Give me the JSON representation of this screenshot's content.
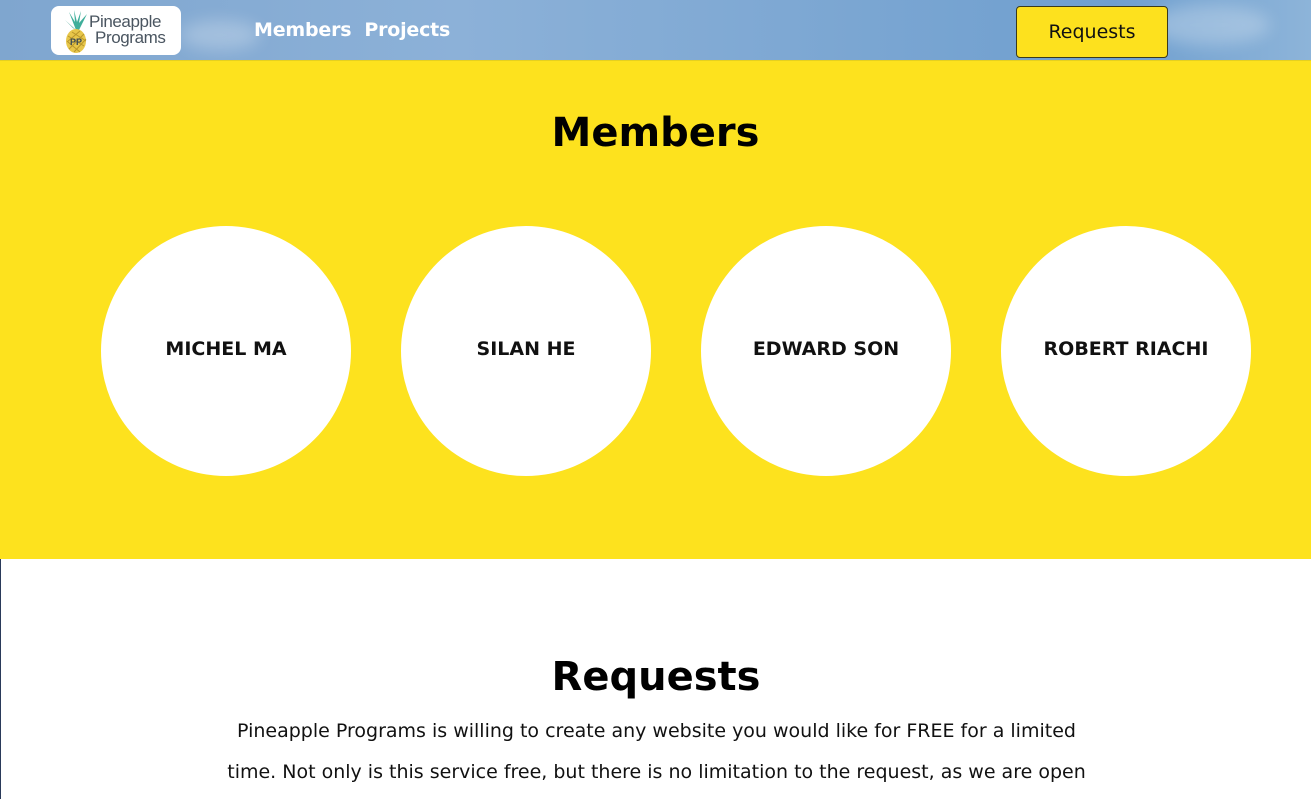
{
  "navbar": {
    "logo": {
      "line1": "Pineapple",
      "line2": "Programs",
      "icon": "pineapple-logo-icon"
    },
    "links": [
      {
        "label": "Members"
      },
      {
        "label": "Projects"
      }
    ],
    "requests_button": "Requests"
  },
  "members": {
    "title": "Members",
    "people": [
      {
        "name": "MICHEL MA"
      },
      {
        "name": "SILAN HE"
      },
      {
        "name": "EDWARD SON"
      },
      {
        "name": "ROBERT RIACHI"
      }
    ]
  },
  "requests": {
    "title": "Requests",
    "text": "Pineapple Programs is willing to create any website you would like for FREE for a limited time. Not only is this service free, but there is no limitation to the request, as we are open"
  },
  "colors": {
    "accent_yellow": "#fde21e",
    "nav_sky_blue": "#7fa6cf",
    "text_dark": "#111111"
  }
}
